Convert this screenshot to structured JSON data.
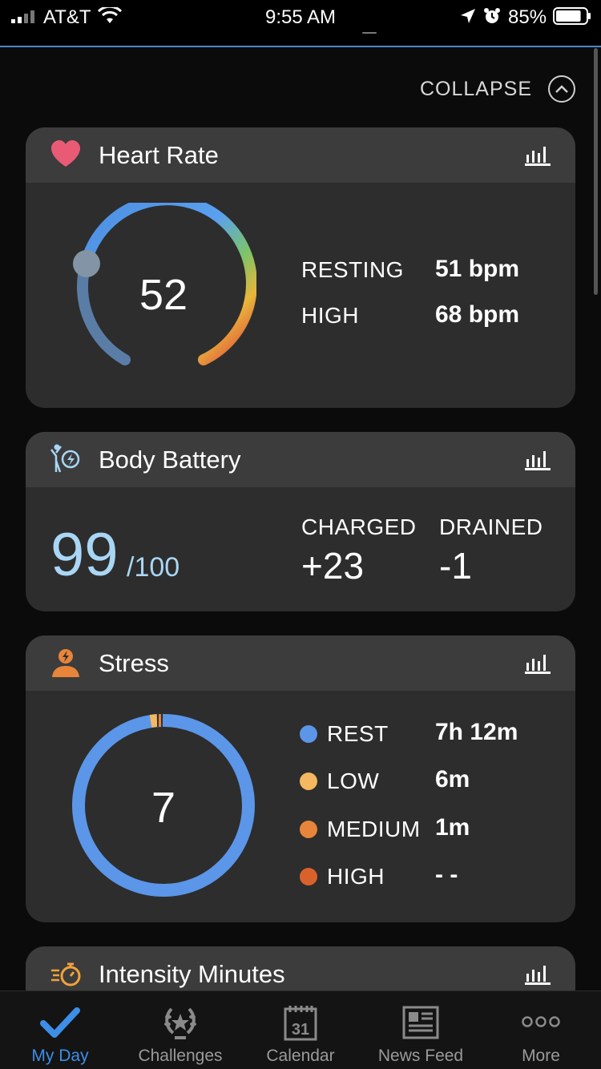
{
  "status_bar": {
    "carrier": "AT&T",
    "time": "9:55 AM",
    "battery_pct": "85%",
    "battery_level": 0.85,
    "icons": [
      "signal-icon",
      "wifi-icon",
      "location-arrow-icon",
      "alarm-icon",
      "battery-icon"
    ]
  },
  "collapse": {
    "label": "COLLAPSE",
    "icon": "chevron-up-icon"
  },
  "heart_rate": {
    "title": "Heart Rate",
    "icon": "heart-icon",
    "current": "52",
    "resting_label": "RESTING",
    "resting_value": "51 bpm",
    "high_label": "HIGH",
    "high_value": "68 bpm",
    "accent": "#e95b75"
  },
  "body_battery": {
    "title": "Body Battery",
    "icon": "body-battery-icon",
    "value": "99",
    "max": "/100",
    "charged_label": "CHARGED",
    "charged_value": "+23",
    "drained_label": "DRAINED",
    "drained_value": "-1",
    "accent": "#a9d6f5"
  },
  "stress": {
    "title": "Stress",
    "icon": "stress-person-icon",
    "current": "7",
    "rows": [
      {
        "label": "REST",
        "value": "7h 12m",
        "color": "#5b96e8"
      },
      {
        "label": "LOW",
        "value": "6m",
        "color": "#f4b860"
      },
      {
        "label": "MEDIUM",
        "value": "1m",
        "color": "#e8853a"
      },
      {
        "label": "HIGH",
        "value": "- -",
        "color": "#d9622b"
      }
    ]
  },
  "intensity": {
    "title": "Intensity Minutes",
    "icon": "stopwatch-icon",
    "accent": "#f2a23a"
  },
  "tabs": [
    {
      "label": "My Day",
      "icon": "checkmark-icon",
      "active": true
    },
    {
      "label": "Challenges",
      "icon": "laurel-trophy-icon",
      "active": false
    },
    {
      "label": "Calendar",
      "icon": "calendar-icon",
      "active": false,
      "day": "31"
    },
    {
      "label": "News Feed",
      "icon": "newspaper-icon",
      "active": false
    },
    {
      "label": "More",
      "icon": "more-dots-icon",
      "active": false
    }
  ]
}
